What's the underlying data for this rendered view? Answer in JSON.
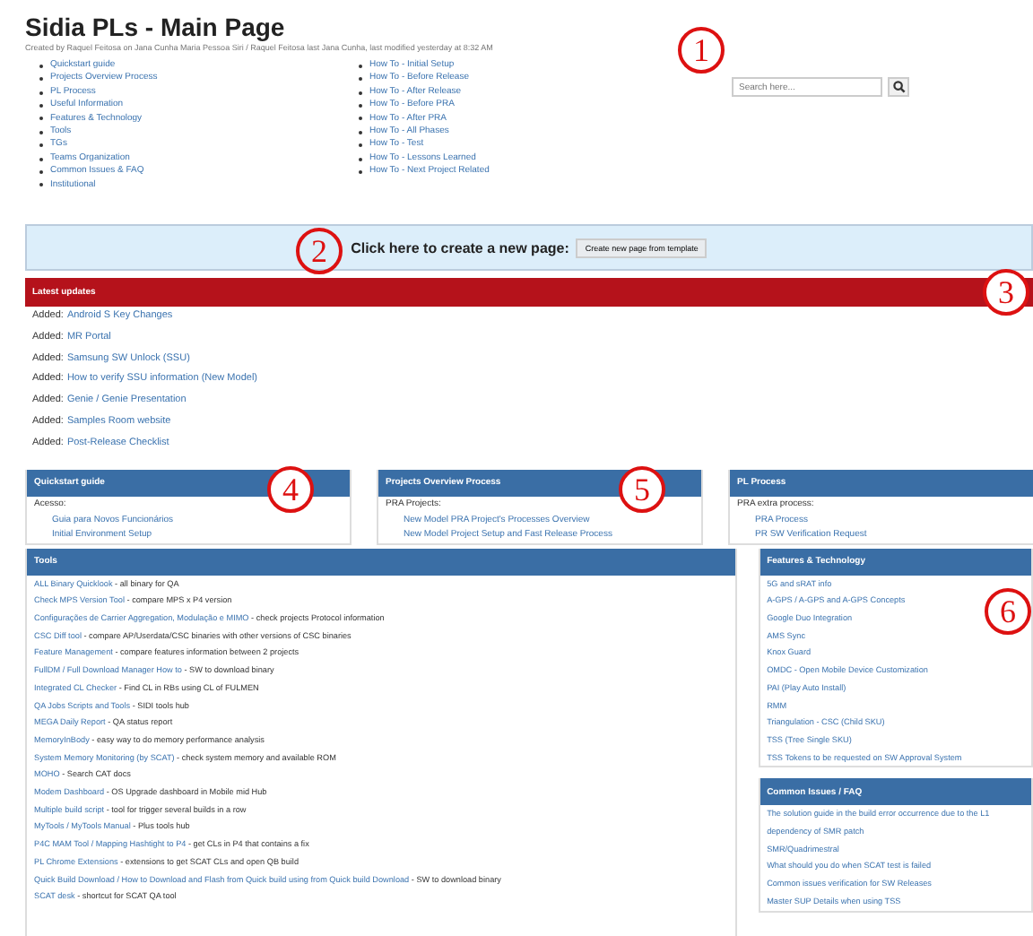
{
  "page": {
    "title": "Sidia PLs - Main Page",
    "byline": "Created by Raquel Feitosa on Jana Cunha Maria Pessoa Siri / Raquel Feitosa last Jana Cunha, last modified yesterday at 8:32 AM"
  },
  "toc_left": [
    "Quickstart guide",
    "Projects Overview Process",
    "PL Process",
    "Useful Information",
    "Features & Technology",
    "Tools",
    "TGs",
    "Teams Organization",
    "Common Issues & FAQ",
    "Institutional"
  ],
  "toc_right": [
    "How To - Initial Setup",
    "How To - Before Release",
    "How To - After Release",
    "How To - Before PRA",
    "How To - After PRA",
    "How To - All Phases",
    "How To - Test",
    "How To - Lessons Learned",
    "How To - Next Project Related"
  ],
  "search": {
    "placeholder": "Search here...",
    "callout": "1"
  },
  "create": {
    "label": "Click here to create a new page:",
    "button": "Create new page from template",
    "callout": "2"
  },
  "updates": {
    "title": "Latest updates",
    "callout": "3",
    "items": [
      {
        "prefix": "Added:",
        "link": "Android S Key Changes"
      },
      {
        "prefix": "Added:",
        "link": "MR Portal"
      },
      {
        "prefix": "Added:",
        "link": "Samsung SW Unlock (SSU)"
      },
      {
        "prefix": "Added:",
        "link": "How to verify SSU information (New Model)"
      },
      {
        "prefix": "Added:",
        "link": "Genie / Genie Presentation"
      },
      {
        "prefix": "Added:",
        "link": "Samples Room website"
      },
      {
        "prefix": "Added:",
        "link": "Post-Release Checklist"
      }
    ]
  },
  "panels": [
    {
      "title": "Quickstart guide",
      "callout": "4",
      "intro": "Acesso:",
      "links": [
        "Guia para Novos Funcionários",
        "Initial Environment Setup"
      ]
    },
    {
      "title": "Projects Overview Process",
      "callout": "5",
      "intro": "PRA Projects:",
      "links": [
        "New Model PRA Project's Processes Overview",
        "New Model Project Setup and Fast Release Process"
      ]
    },
    {
      "title": "PL Process",
      "intro": "PRA extra process:",
      "links": [
        "PRA Process",
        "PR SW Verification Request"
      ]
    }
  ],
  "tools": {
    "title": "Tools",
    "items": [
      {
        "link": "ALL Binary Quicklook",
        "desc": " - all binary for QA"
      },
      {
        "link": "Check MPS Version Tool",
        "desc": " - compare MPS x P4 version"
      },
      {
        "link": "Configurações de Carrier Aggregation, Modulação e MIMO",
        "desc": " - check projects Protocol information"
      },
      {
        "link": "CSC Diff tool",
        "desc": " - compare AP/Userdata/CSC binaries with other versions of CSC binaries"
      },
      {
        "link": "Feature Management",
        "desc": " - compare features information between 2 projects"
      },
      {
        "link": "FullDM / Full Download Manager How to",
        "desc": " - SW to download binary"
      },
      {
        "link": "Integrated CL Checker",
        "desc": " - Find CL in RBs using CL of FULMEN"
      },
      {
        "link": "QA Jobs Scripts and Tools",
        "desc": " - SIDI tools hub"
      },
      {
        "link": "MEGA Daily Report",
        "desc": " - QA status report"
      },
      {
        "link": "MemoryInBody",
        "desc": " - easy way to do memory performance analysis"
      },
      {
        "link": "System Memory Monitoring (by SCAT)",
        "desc": " - check system memory and available ROM"
      },
      {
        "link": "MOHO",
        "desc": " - Search CAT docs"
      },
      {
        "link": "Modem Dashboard",
        "desc": " - OS Upgrade dashboard in Mobile mid Hub"
      },
      {
        "link": "Multiple build script",
        "desc": " - tool for trigger several builds in a row"
      },
      {
        "link": "MyTools / MyTools Manual",
        "desc": " - Plus tools hub"
      },
      {
        "link": "P4C MAM Tool / Mapping Hashtight to P4",
        "desc": " - get CLs in P4 that contains a fix"
      },
      {
        "link": "PL Chrome Extensions",
        "desc": " - extensions to get SCAT CLs and open QB build"
      },
      {
        "link": "Quick Build Download / How to Download and Flash from Quick build using from Quick build Download",
        "desc": " - SW to download binary"
      },
      {
        "link": "SCAT desk",
        "desc": " - shortcut for SCAT QA tool"
      }
    ]
  },
  "features": {
    "title": "Features & Technology",
    "callout": "6",
    "links": [
      "5G and sRAT info",
      "A-GPS / A-GPS and A-GPS Concepts",
      "Google Duo Integration",
      "AMS Sync",
      "Knox Guard",
      "OMDC - Open Mobile Device Customization",
      "PAI (Play Auto Install)",
      "RMM",
      "Triangulation - CSC (Child SKU)",
      "TSS (Tree Single SKU)",
      "TSS Tokens to be requested on SW Approval System"
    ]
  },
  "faq": {
    "title": "Common Issues / FAQ",
    "links": [
      "The solution guide in the build error occurrence due to the L1 dependency of SMR patch",
      "SMR/Quadrimestral",
      "What should you do when SCAT test is failed",
      "Common issues verification for SW Releases",
      "Master SUP Details when using TSS"
    ]
  }
}
